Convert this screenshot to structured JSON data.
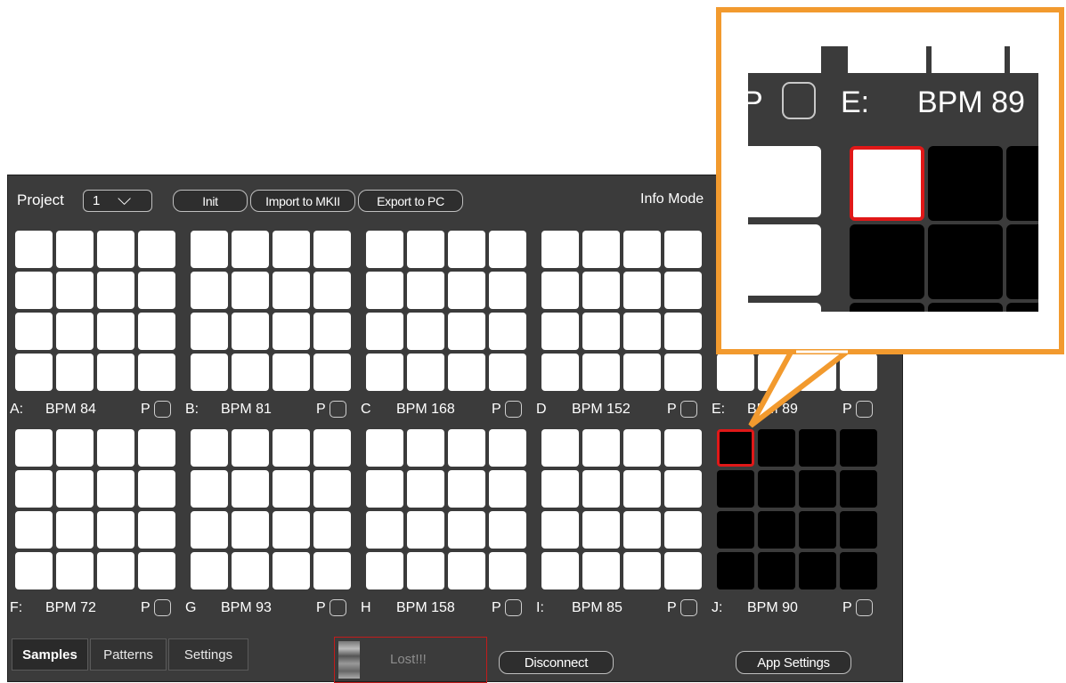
{
  "toolbar": {
    "project_label": "Project",
    "project_value": "1",
    "init_label": "Init",
    "import_label": "Import to MKII",
    "export_label": "Export to PC",
    "info_mode_label": "Info Mode"
  },
  "groups": [
    {
      "letter": "A:",
      "bpm": "BPM 84"
    },
    {
      "letter": "B:",
      "bpm": "BPM 81"
    },
    {
      "letter": "C",
      "bpm": "BPM 168"
    },
    {
      "letter": "D",
      "bpm": "BPM 152"
    },
    {
      "letter": "E:",
      "bpm": "BPM 89"
    },
    {
      "letter": "F:",
      "bpm": "BPM 72"
    },
    {
      "letter": "G",
      "bpm": "BPM 93"
    },
    {
      "letter": "H",
      "bpm": "BPM 158"
    },
    {
      "letter": "I:",
      "bpm": "BPM 85"
    },
    {
      "letter": "J:",
      "bpm": "BPM 90"
    }
  ],
  "p_label": "P",
  "tabs": [
    "Samples",
    "Patterns",
    "Settings"
  ],
  "status": {
    "text": "Lost!!!"
  },
  "disconnect_label": "Disconnect",
  "app_settings_label": "App Settings",
  "callout": {
    "p_label": "P",
    "letter": "E:",
    "bpm": "BPM 89"
  },
  "colors": {
    "accent_callout": "#f29a2e",
    "selection": "#e01818",
    "panel": "#3b3b3b"
  }
}
